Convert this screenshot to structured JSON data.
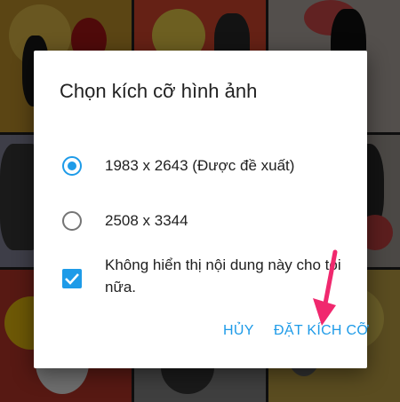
{
  "background": {
    "photo_count": 9,
    "scrim_color": "rgba(0,0,0,0.55)"
  },
  "dialog": {
    "title": "Chọn kích cỡ hình ảnh",
    "options": [
      {
        "label": "1983 x 2643 (Được đề xuất)",
        "selected": true
      },
      {
        "label": "2508 x 3344",
        "selected": false
      }
    ],
    "checkbox": {
      "label": "Không hiển thị nội dung này cho tôi nữa.",
      "checked": true
    },
    "buttons": {
      "cancel": "HỦY",
      "confirm": "ĐẶT KÍCH CỠ"
    }
  },
  "annotation": {
    "type": "arrow",
    "color": "#f0286e",
    "points_to": "confirm-button"
  },
  "colors": {
    "accent": "#1e9be8",
    "text_primary": "#212121",
    "radio_unselected": "#757575"
  },
  "icons": {
    "radio_selected": "radio-selected-icon",
    "radio_unselected": "radio-unselected-icon",
    "checkbox": "checkbox-checked-icon",
    "arrow": "annotation-arrow-icon"
  }
}
